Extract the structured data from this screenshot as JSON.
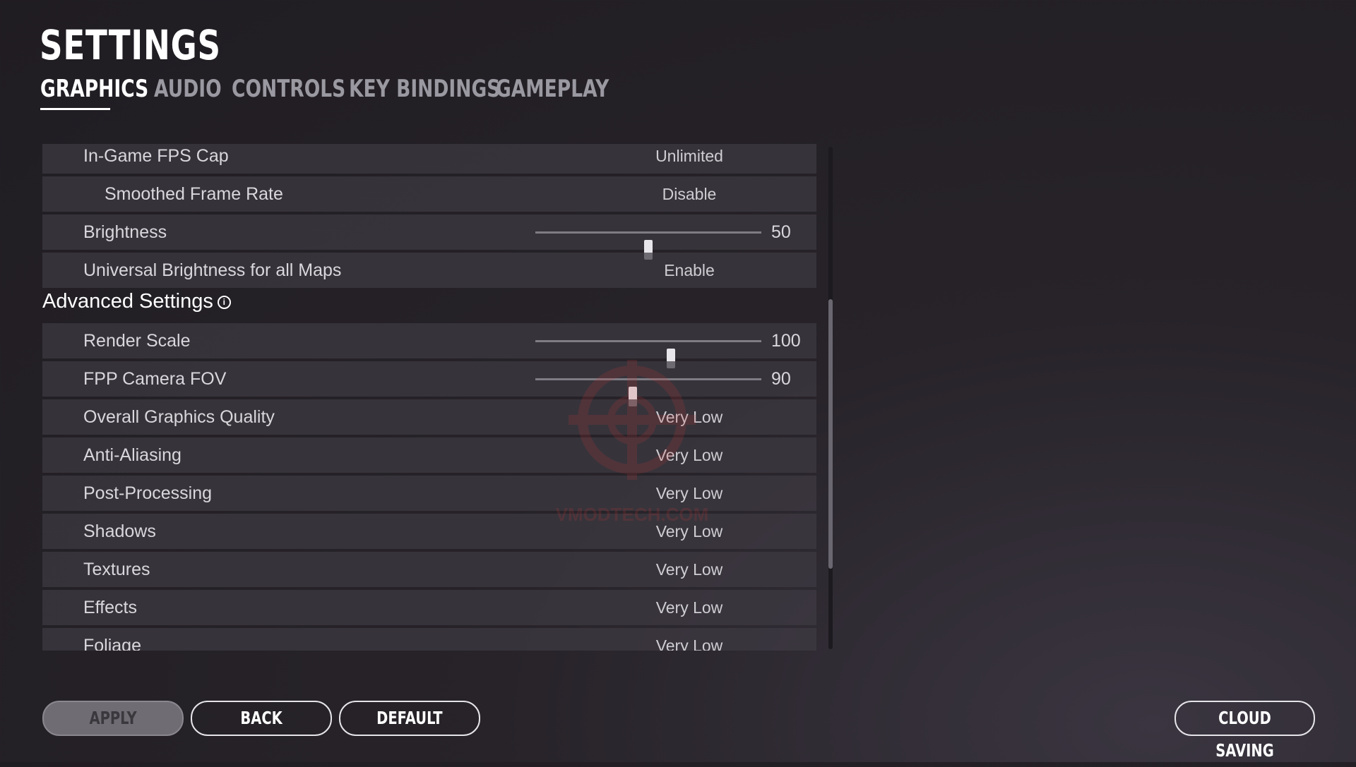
{
  "page_title": "SETTINGS",
  "tabs": [
    {
      "label": "GRAPHICS",
      "active": true
    },
    {
      "label": "AUDIO",
      "active": false
    },
    {
      "label": "CONTROLS",
      "active": false
    },
    {
      "label": "KEY BINDINGS",
      "active": false
    },
    {
      "label": "GAMEPLAY",
      "active": false
    }
  ],
  "basic_rows": [
    {
      "label": "In-Game FPS Cap",
      "value": "Unlimited"
    },
    {
      "label": "Smoothed Frame Rate",
      "value": "Disable"
    },
    {
      "label": "Brightness",
      "slider_value": "50",
      "slider_fraction": 0.5
    },
    {
      "label": "Universal Brightness for all Maps",
      "value": "Enable"
    }
  ],
  "advanced": {
    "heading": "Advanced Settings",
    "info_glyph": "i",
    "rows": [
      {
        "label": "Render Scale",
        "slider_value": "100",
        "slider_fraction": 0.6
      },
      {
        "label": "FPP Camera FOV",
        "slider_value": "90",
        "slider_fraction": 0.43
      },
      {
        "label": "Overall Graphics Quality",
        "value": "Very Low"
      },
      {
        "label": "Anti-Aliasing",
        "value": "Very Low"
      },
      {
        "label": "Post-Processing",
        "value": "Very Low"
      },
      {
        "label": "Shadows",
        "value": "Very Low"
      },
      {
        "label": "Textures",
        "value": "Very Low"
      },
      {
        "label": "Effects",
        "value": "Very Low"
      },
      {
        "label": "Foliage",
        "value": "Very Low"
      }
    ]
  },
  "buttons": {
    "apply": "APPLY",
    "back": "BACK",
    "default": "DEFAULT",
    "cloud_saving": "CLOUD SAVING"
  },
  "watermark_text": "VMODTECH.COM",
  "colors": {
    "background": "#252228",
    "row_background": "#3e3a42",
    "text": "#d9d7dc",
    "active_tab": "#ffffff",
    "inactive_tab": "#9a98a0"
  }
}
